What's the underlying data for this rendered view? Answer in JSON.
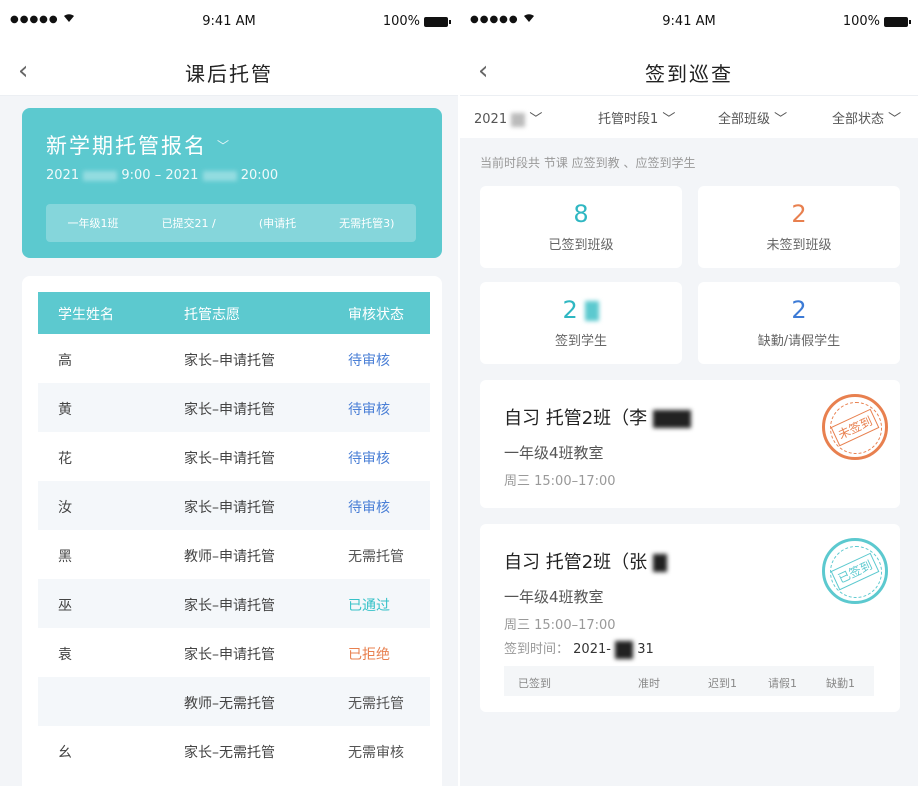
{
  "left": {
    "status": {
      "dots": "●●●●●",
      "time": "9:41 AM",
      "battery": "100%"
    },
    "nav": {
      "back": "‹",
      "title": "课后托管"
    },
    "promo": {
      "title": "新学期托管报名",
      "date_start": "2021",
      "time_start": "9:00",
      "sep": "–",
      "date_end": "2021",
      "time_end": "20:00",
      "stats": [
        "一年级1班",
        "已提交21 /",
        "(申请托",
        "无需托管3)"
      ]
    },
    "table": {
      "headers": [
        "学生姓名",
        "托管志愿",
        "审核状态"
      ],
      "rows": [
        {
          "name": "高",
          "choice": "家长–申请托管",
          "status": "待审核",
          "status_type": "pending"
        },
        {
          "name": "黄",
          "choice": "家长–申请托管",
          "status": "待审核",
          "status_type": "pending"
        },
        {
          "name": "花",
          "choice": "家长–申请托管",
          "status": "待审核",
          "status_type": "pending"
        },
        {
          "name": "汝",
          "choice": "家长–申请托管",
          "status": "待审核",
          "status_type": "pending"
        },
        {
          "name": "黑",
          "choice": "教师–申请托管",
          "status": "无需托管",
          "status_type": "none"
        },
        {
          "name": "巫",
          "choice": "家长–申请托管",
          "status": "已通过",
          "status_type": "pass"
        },
        {
          "name": "袁",
          "choice": "家长–申请托管",
          "status": "已拒绝",
          "status_type": "reject"
        },
        {
          "name": "",
          "choice": "教师–无需托管",
          "status": "无需托管",
          "status_type": "none"
        },
        {
          "name": "幺",
          "choice": "家长–无需托管",
          "status": "无需审核",
          "status_type": "none"
        }
      ]
    }
  },
  "right": {
    "status": {
      "dots": "●●●●●",
      "time": "9:41 AM",
      "battery": "100%"
    },
    "nav": {
      "back": "‹",
      "title": "签到巡查"
    },
    "filters": [
      "2021",
      "托管时段1",
      "全部班级",
      "全部状态"
    ],
    "info": "当前时段共  节课   应签到教   、应签到学生",
    "stats": [
      {
        "num": "8",
        "label": "已签到班级",
        "color": "teal"
      },
      {
        "num": "2",
        "label": "未签到班级",
        "color": "orange"
      },
      {
        "num": "2",
        "label": "签到学生",
        "color": "teal"
      },
      {
        "num": "2",
        "label": "缺勤/请假学生",
        "color": "blue"
      }
    ],
    "cards": [
      {
        "title": "自习   托管2班（李",
        "room": "一年级4班教室",
        "time": "周三  15:00–17:00",
        "stamp": "未签到"
      },
      {
        "title": "自习   托管2班（张",
        "room": "一年级4班教室",
        "time": "周三  15:00–17:00",
        "signed_label": "签到时间：",
        "signed_date": "2021-",
        "signed_tail": "31",
        "stamp": "已签到",
        "substats": [
          "已签到",
          "准时",
          "迟到1",
          "请假1",
          "缺勤1"
        ]
      }
    ]
  }
}
